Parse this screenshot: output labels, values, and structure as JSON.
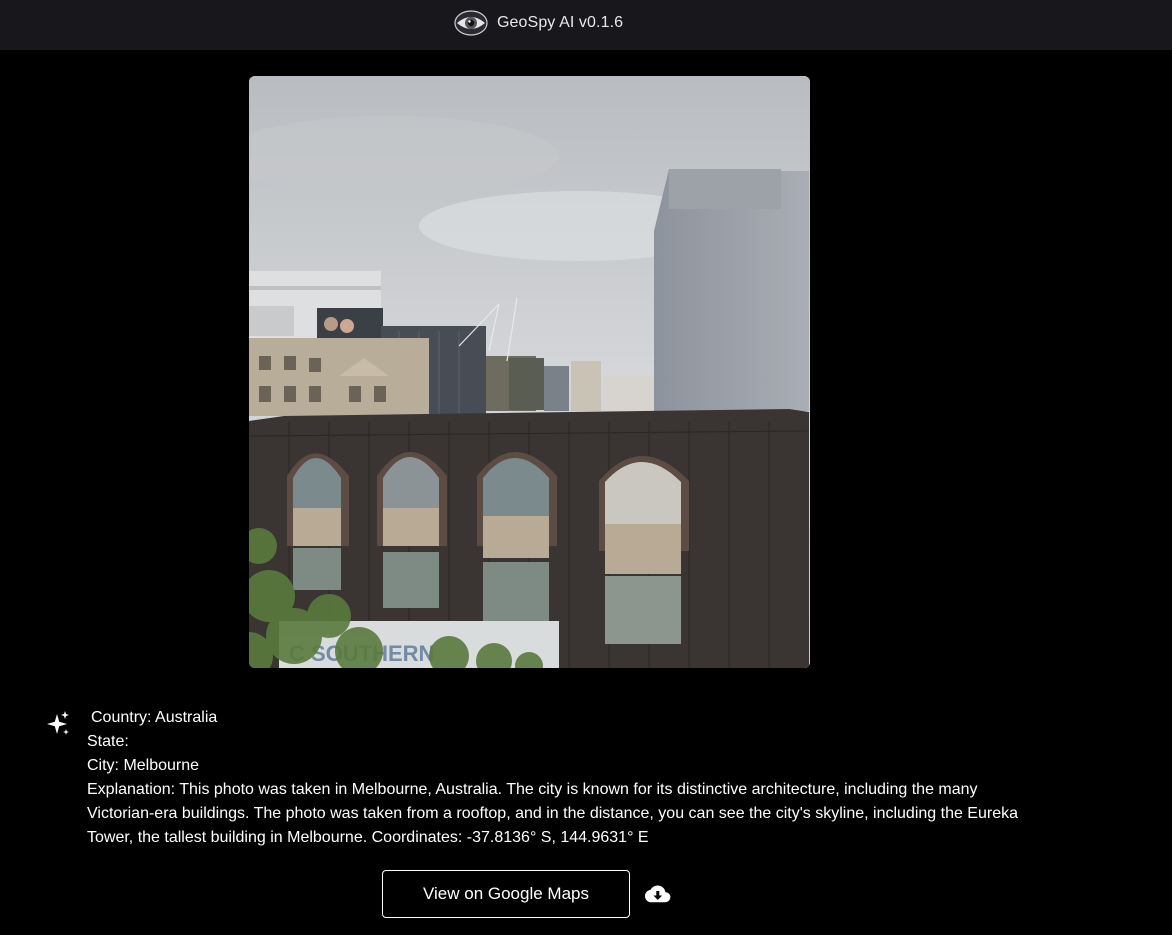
{
  "header": {
    "logo_icon": "eye-logo-icon",
    "title": "GeoSpy AI v0.1.6",
    "background": "#18171c"
  },
  "photo": {
    "subject": "uploaded-photo"
  },
  "result": {
    "icon": "sparkle-icon",
    "country_line": "Country: Australia",
    "state_line": "State:",
    "city_line": "City: Melbourne",
    "explanation_line": "Explanation: This photo was taken in Melbourne, Australia. The city is known for its distinctive architecture, including the many Victorian-era buildings. The photo was taken from a rooftop, and in the distance, you can see the city's skyline, including the Eureka Tower, the tallest building in Melbourne. Coordinates: -37.8136° S, 144.9631° E"
  },
  "actions": {
    "maps_button_label": "View on Google Maps",
    "download_icon": "cloud-download-icon"
  },
  "colors": {
    "page_background": "#000000",
    "text": "#ffffff"
  }
}
